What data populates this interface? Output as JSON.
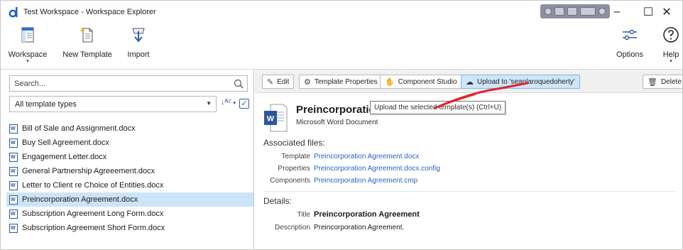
{
  "window": {
    "title": "Test Workspace - Workspace Explorer",
    "minimize": "–",
    "maximize": "☐",
    "close": "✕"
  },
  "ribbon": {
    "workspace_label": "Workspace",
    "new_template_label": "New Template",
    "import_label": "Import",
    "options_label": "Options",
    "help_label": "Help"
  },
  "left": {
    "search_placeholder": "Search...",
    "type_filter": "All template types",
    "templates": [
      "Bill of Sale and Assignment.docx",
      "Buy Sell Agreement.docx",
      "Engagement Letter.docx",
      "General Partnership Agreeement.docx",
      "Letter to Client re Choice of Entities.docx",
      "Preincorporation Agreement.docx",
      "Subscription Agreement Long Form.docx",
      "Subscription Agreement Short Form.docx"
    ],
    "selected_index": 5
  },
  "toolbar": {
    "edit": "Edit",
    "template_properties": "Template Properties",
    "component_studio": "Component Studio",
    "upload": "Upload to 'seanlaroquedoherty'",
    "delete": "Delete"
  },
  "detail": {
    "title": "Preincorporation",
    "tooltip": "Upload the selected template(s) (Ctrl+U)",
    "subtitle": "Microsoft Word Document",
    "associated_heading": "Associated files:",
    "template_label": "Template",
    "template_file": "Preincorporation Agreement.docx",
    "properties_label": "Properties",
    "properties_file": "Preincorporation Agreement.docx.config",
    "components_label": "Components",
    "components_file": "Preincorporation Agreement.cmp",
    "details_heading": "Details:",
    "title_label": "Title",
    "title_value": "Preincorporation Agreement",
    "description_label": "Description",
    "description_value": "Preincorporation Agreement."
  },
  "colors": {
    "selection": "#cce4f7",
    "link": "#2a63c7",
    "upload_button": "#cfe5f8",
    "annotation_arrow": "#e0242a"
  }
}
